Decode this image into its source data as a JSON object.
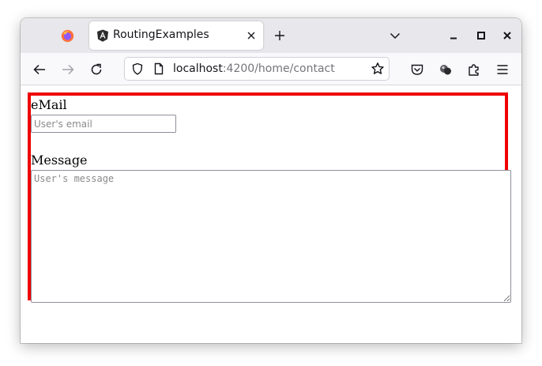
{
  "browser": {
    "tab": {
      "title": "RoutingExamples",
      "favicon": "angular-logo-icon"
    },
    "address": {
      "host": "localhost",
      "rest": ":4200/home/contact"
    },
    "icons": {
      "firefox": "firefox-logo-icon",
      "back": "back-arrow-icon",
      "forward": "forward-arrow-icon",
      "reload": "reload-icon",
      "shield": "tracking-protection-shield-icon",
      "page": "page-info-icon",
      "bookmark": "bookmark-star-icon",
      "pocket": "pocket-icon",
      "extension_user": "extension-avatar-icon",
      "extensions": "extensions-puzzle-icon",
      "menu": "hamburger-menu-icon",
      "new_tab": "plus-icon",
      "tab_list": "chevron-down-icon",
      "minimize": "minimize-icon",
      "maximize": "maximize-icon",
      "close": "close-icon"
    }
  },
  "form": {
    "email_label": "eMail",
    "email_placeholder": "User's email",
    "message_label": "Message",
    "message_placeholder": "User's message"
  },
  "colors": {
    "highlight_border": "#ee0000",
    "tabbar_bg": "#e8e7eb",
    "toolbar_bg": "#f9f9fb"
  }
}
